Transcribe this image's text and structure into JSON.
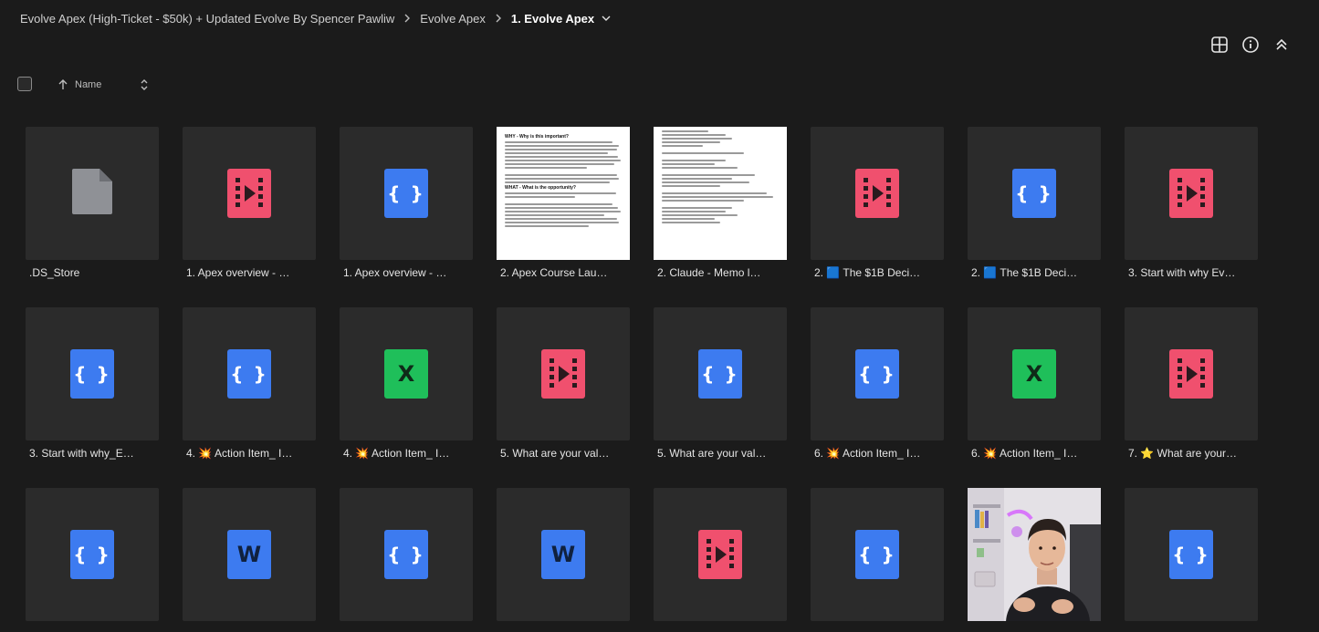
{
  "breadcrumb": {
    "items": [
      "Evolve Apex (High-Ticket - $50k) + Updated Evolve By Spencer Pawliw",
      "Evolve Apex",
      "1. Evolve Apex"
    ]
  },
  "toolbar": {
    "sort_label": "Name",
    "icons": [
      "grid-view-icon",
      "info-icon",
      "collapse-icon"
    ]
  },
  "colors": {
    "json": "#3d7bf0",
    "video": "#f0506e",
    "excel": "#1fbf5a",
    "word": "#3d7bf0",
    "background": "#1b1b1b",
    "tile": "#2b2b2b"
  },
  "doc_thumbs": {
    "apex_course": {
      "heading1": "WHY - Why is this important?",
      "heading2": "WHAT - What is the opportunity?"
    }
  },
  "files": [
    {
      "name": ".DS_Store",
      "type": "generic"
    },
    {
      "name": "1. Apex overview - …",
      "type": "video"
    },
    {
      "name": "1. Apex overview - …",
      "type": "json"
    },
    {
      "name": "2. Apex Course Lau…",
      "type": "doc1"
    },
    {
      "name": "2. Claude - Memo l…",
      "type": "doc2"
    },
    {
      "name": "2. 🟦 The $1B Deci…",
      "type": "video"
    },
    {
      "name": "2. 🟦 The $1B Deci…",
      "type": "json"
    },
    {
      "name": "3. Start with why Ev…",
      "type": "video"
    },
    {
      "name": "3. Start with why_E…",
      "type": "json"
    },
    {
      "name": "4. 💥 Action Item_ I…",
      "type": "json"
    },
    {
      "name": "4. 💥 Action Item_ I…",
      "type": "excel"
    },
    {
      "name": "5. What are your val…",
      "type": "video"
    },
    {
      "name": "5. What are your val…",
      "type": "json"
    },
    {
      "name": "6. 💥 Action Item_ I…",
      "type": "json"
    },
    {
      "name": "6. 💥 Action Item_ I…",
      "type": "excel"
    },
    {
      "name": "7. ⭐ What are your…",
      "type": "video"
    },
    {
      "name": "",
      "type": "json"
    },
    {
      "name": "",
      "type": "word"
    },
    {
      "name": "",
      "type": "json"
    },
    {
      "name": "",
      "type": "word"
    },
    {
      "name": "",
      "type": "video"
    },
    {
      "name": "",
      "type": "json"
    },
    {
      "name": "",
      "type": "photo"
    },
    {
      "name": "",
      "type": "json"
    }
  ]
}
